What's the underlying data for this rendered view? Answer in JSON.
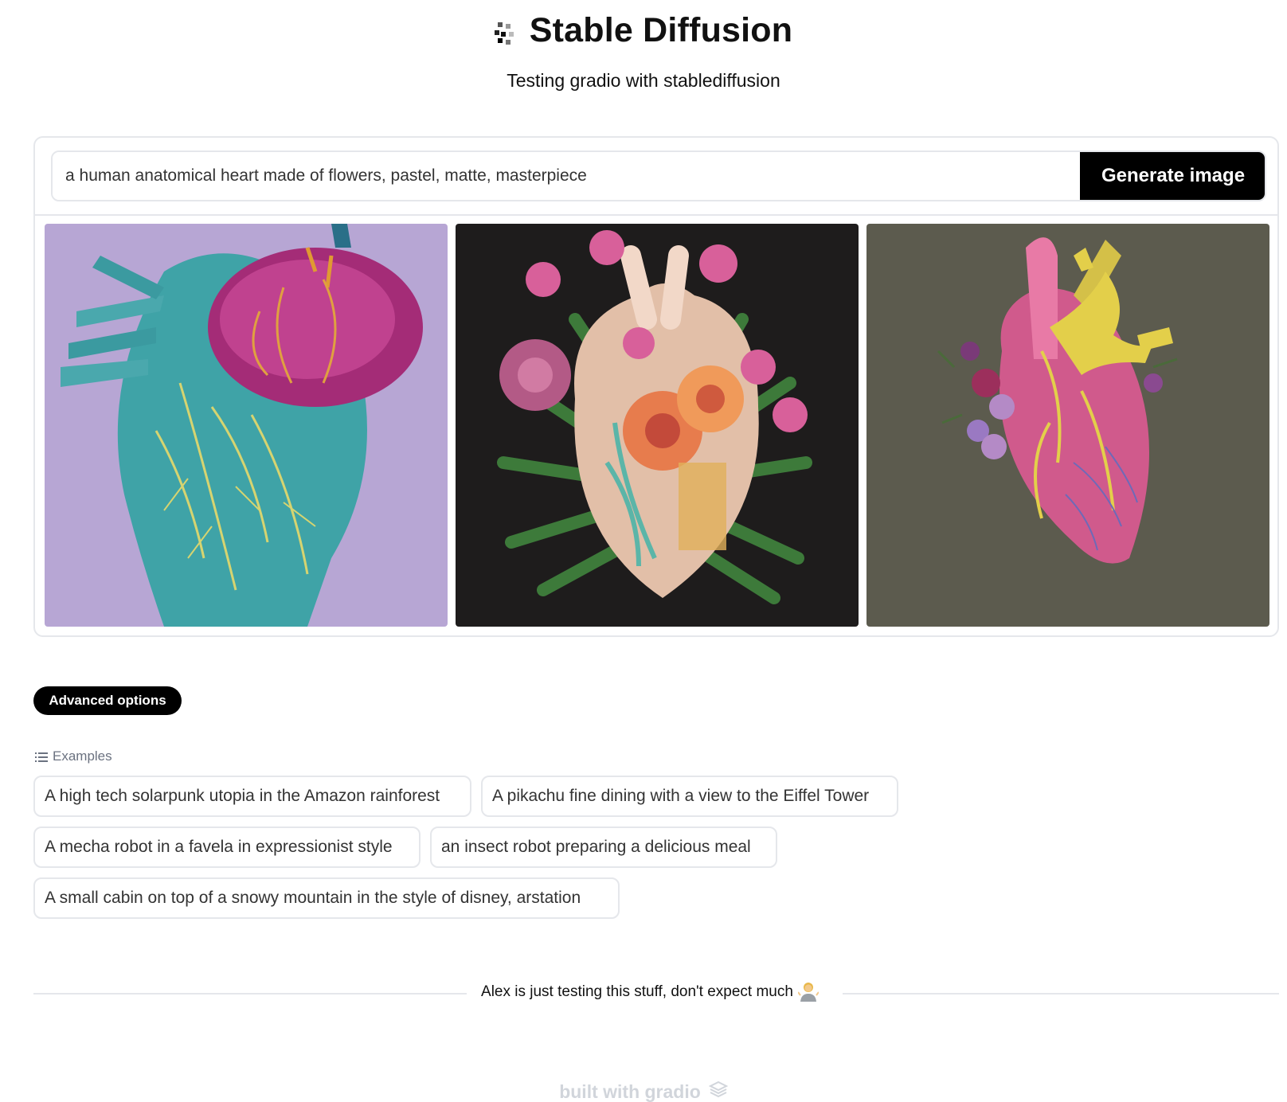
{
  "header": {
    "title": "Stable Diffusion",
    "subtitle": "Testing gradio with stablediffusion"
  },
  "prompt": {
    "value": "a human anatomical heart made of flowers, pastel, matte, masterpiece",
    "button_label": "Generate image"
  },
  "gallery": {
    "images": [
      {
        "icon": "generated-image-heart-teal"
      },
      {
        "icon": "generated-image-heart-flowers"
      },
      {
        "icon": "generated-image-heart-pink"
      }
    ]
  },
  "advanced": {
    "label": "Advanced options"
  },
  "examples": {
    "label": "Examples",
    "items": [
      "A high tech solarpunk utopia in the Amazon rainforest",
      "A pikachu fine dining with a view to the Eiffel Tower",
      "A mecha robot in a favela in expressionist style",
      "an insect robot preparing a delicious meal",
      "A small cabin on top of a snowy mountain in the style of disney, arstation"
    ]
  },
  "footer": {
    "note": "Alex is just testing this stuff, don't expect much",
    "built_with": "built with gradio"
  },
  "colors": {
    "button_bg": "#000000",
    "border": "#e5e7eb",
    "muted": "#6b7280"
  }
}
